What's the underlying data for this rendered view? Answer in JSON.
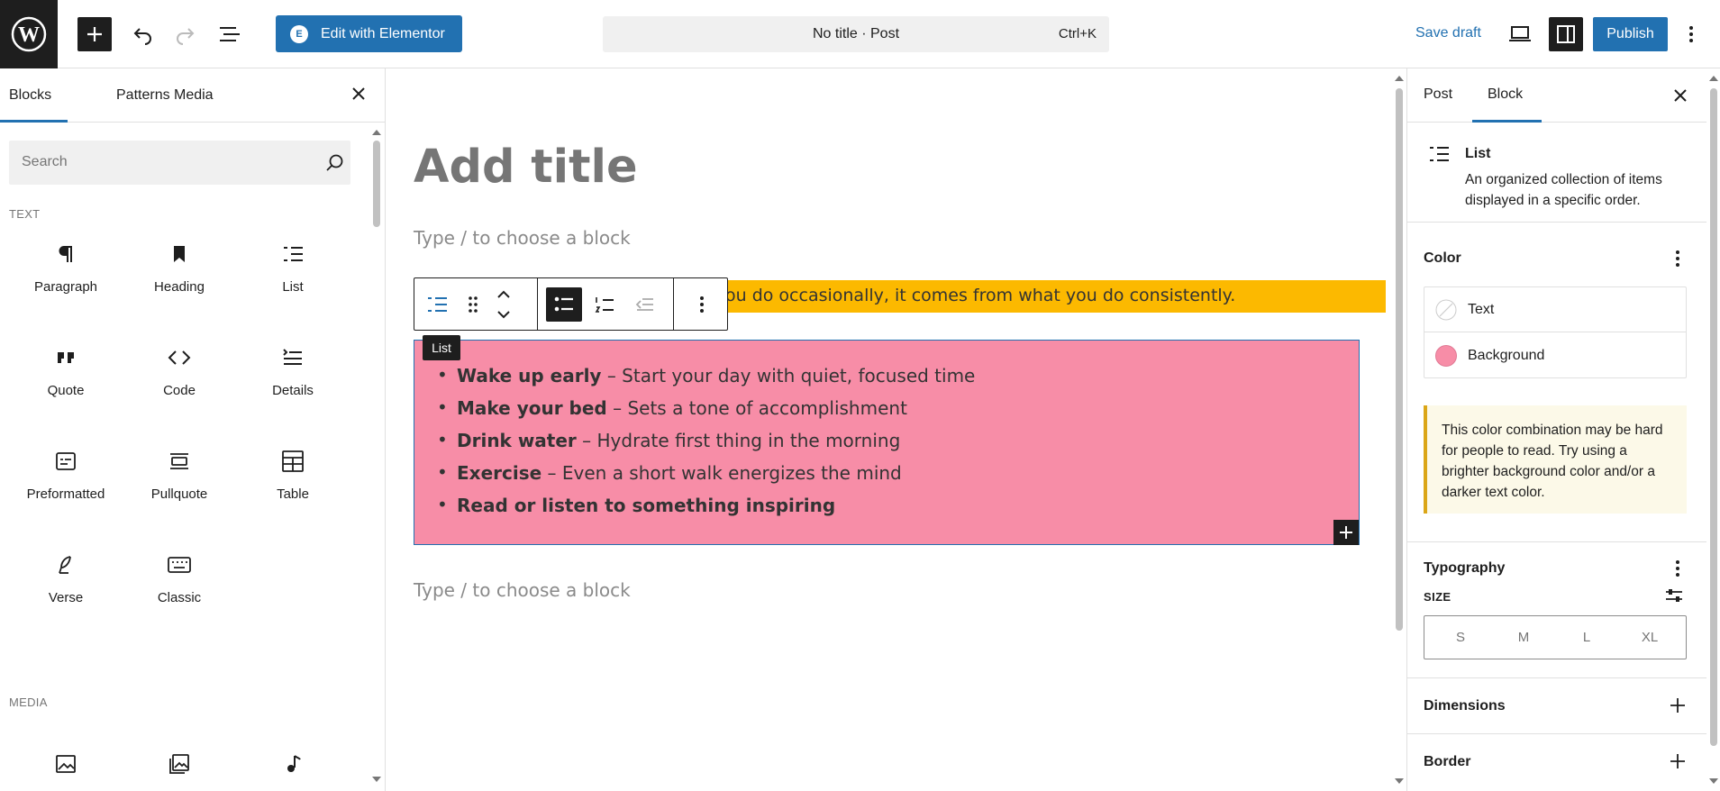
{
  "topbar": {
    "elementor_label": "Edit with Elementor",
    "elementor_icon": "E",
    "command_title": "No title · Post",
    "command_shortcut": "Ctrl+K",
    "save_draft": "Save draft",
    "publish": "Publish"
  },
  "inserter": {
    "tabs": {
      "blocks": "Blocks",
      "patterns": "Patterns",
      "media": "Media"
    },
    "search_placeholder": "Search",
    "categories": {
      "text": "TEXT",
      "media": "MEDIA"
    },
    "blocks": [
      {
        "label": "Paragraph",
        "icon": "paragraph-icon"
      },
      {
        "label": "Heading",
        "icon": "heading-icon"
      },
      {
        "label": "List",
        "icon": "list-icon"
      },
      {
        "label": "Quote",
        "icon": "quote-icon"
      },
      {
        "label": "Code",
        "icon": "code-icon"
      },
      {
        "label": "Details",
        "icon": "details-icon"
      },
      {
        "label": "Preformatted",
        "icon": "preformatted-icon"
      },
      {
        "label": "Pullquote",
        "icon": "pullquote-icon"
      },
      {
        "label": "Table",
        "icon": "table-icon"
      },
      {
        "label": "Verse",
        "icon": "verse-icon"
      },
      {
        "label": "Classic",
        "icon": "classic-icon"
      }
    ],
    "media_blocks": [
      "image-icon",
      "gallery-icon",
      "audio-icon"
    ]
  },
  "canvas": {
    "title_placeholder": "Add title",
    "block_placeholder_top": "Type / to choose a block",
    "quote_text": "ou do occasionally, it comes from what you do consistently.",
    "tooltip": "List",
    "list_items": [
      {
        "bold": "Wake up early",
        "rest": " – Start your day with quiet, focused time"
      },
      {
        "bold": "Make your bed",
        "rest": " – Sets a tone of accomplishment"
      },
      {
        "bold": "Drink water",
        "rest": " – Hydrate first thing in the morning"
      },
      {
        "bold": "Exercise",
        "rest": " – Even a short walk energizes the mind"
      },
      {
        "bold": "Read or listen to something inspiring",
        "rest": ""
      }
    ],
    "block_placeholder_bottom": "Type / to choose a block",
    "colors": {
      "quote_bg": "#fcb900",
      "list_bg": "#f78da7",
      "accent": "#2271b1"
    }
  },
  "sidebar": {
    "tabs": {
      "post": "Post",
      "block": "Block"
    },
    "block_card": {
      "title": "List",
      "description": "An organized collection of items displayed in a specific order."
    },
    "color_panel": {
      "title": "Color",
      "text_label": "Text",
      "background_label": "Background",
      "background_swatch": "#f78da7"
    },
    "notice": "This color combination may be hard for people to read. Try using a brighter background color and/or a darker text color.",
    "typography": {
      "title": "Typography",
      "size_label": "SIZE",
      "sizes": [
        "S",
        "M",
        "L",
        "XL"
      ]
    },
    "dimensions_title": "Dimensions",
    "border_title": "Border"
  }
}
